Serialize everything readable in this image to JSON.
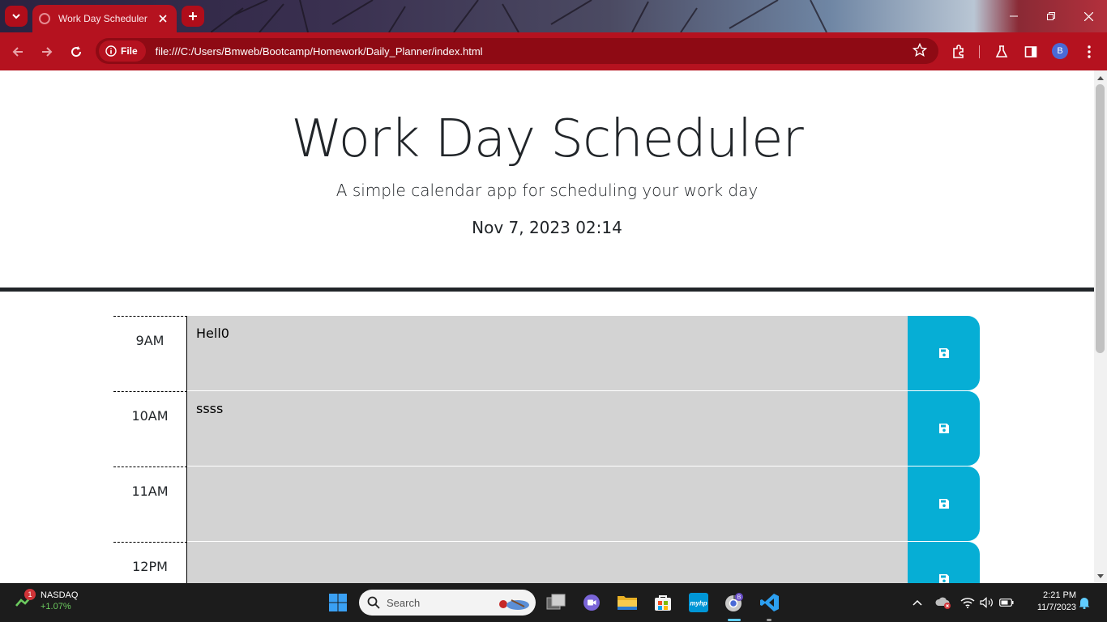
{
  "browser": {
    "tab_title": "Work Day Scheduler",
    "site_chip": "File",
    "url": "file:///C:/Users/Bmweb/Bootcamp/Homework/Daily_Planner/index.html",
    "profile_initial": "B"
  },
  "page": {
    "title": "Work Day Scheduler",
    "lead": "A simple calendar app for scheduling your work day",
    "current_day": "Nov 7, 2023 02:14"
  },
  "time_blocks": [
    {
      "hour": "9AM",
      "text": "Hell0"
    },
    {
      "hour": "10AM",
      "text": "ssss"
    },
    {
      "hour": "11AM",
      "text": ""
    },
    {
      "hour": "12PM",
      "text": ""
    }
  ],
  "taskbar": {
    "widget_badge": "1",
    "widget_name": "NASDAQ",
    "widget_change": "+1.07%",
    "search_label": "Search",
    "time": "2:21 PM",
    "date": "11/7/2023",
    "myhp_label": "myhp",
    "chrome_badge": "B"
  },
  "colors": {
    "chrome_accent": "#b5121f",
    "save_button": "#06aed5",
    "textarea_bg": "#d3d3d3"
  },
  "icons": {
    "save": "floppy-disk-icon"
  }
}
